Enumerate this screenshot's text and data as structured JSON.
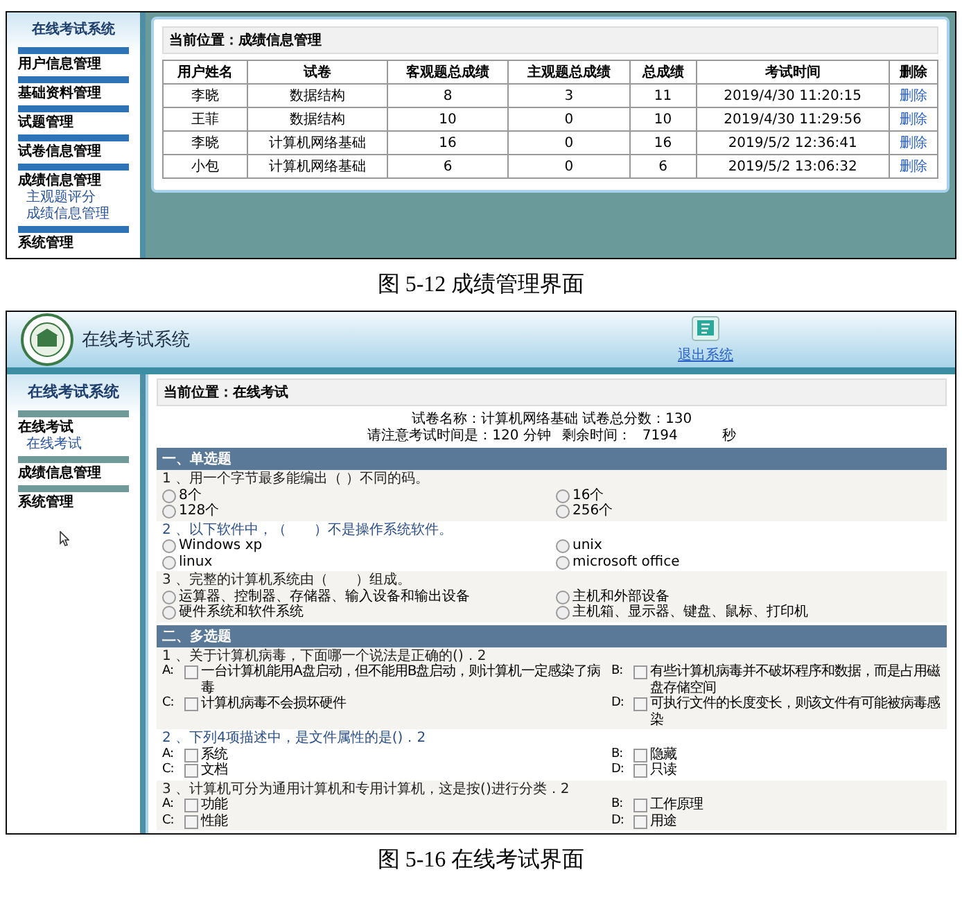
{
  "figures": [
    {
      "kind": "grades",
      "caption": "图 5-12 成绩管理界面",
      "sidebar": {
        "title": "在线考试系统",
        "items": [
          {
            "label": "用户信息管理"
          },
          {
            "label": "基础资料管理"
          },
          {
            "label": "试题管理"
          },
          {
            "label": "试卷信息管理"
          },
          {
            "label": "成绩信息管理",
            "children": [
              {
                "label": "主观题评分"
              },
              {
                "label": "成绩信息管理"
              }
            ]
          },
          {
            "label": "系统管理"
          }
        ]
      },
      "breadcrumb": "当前位置：成绩信息管理",
      "table": {
        "columns": [
          "用户姓名",
          "试卷",
          "客观题总成绩",
          "主观题总成绩",
          "总成绩",
          "考试时间",
          "删除"
        ],
        "rows": [
          {
            "cells": [
              "李晓",
              "数据结构",
              "8",
              "3",
              "11",
              "2019/4/30 11:20:15"
            ],
            "action": "删除"
          },
          {
            "cells": [
              "王菲",
              "数据结构",
              "10",
              "0",
              "10",
              "2019/4/30 11:29:56"
            ],
            "action": "删除"
          },
          {
            "cells": [
              "李晓",
              "计算机网络基础",
              "16",
              "0",
              "16",
              "2019/5/2 12:36:41"
            ],
            "action": "删除"
          },
          {
            "cells": [
              "小包",
              "计算机网络基础",
              "6",
              "0",
              "6",
              "2019/5/2 13:06:32"
            ],
            "action": "删除"
          }
        ]
      }
    },
    {
      "kind": "exam",
      "caption": "图 5-16 在线考试界面",
      "header": {
        "title": "在线考试系统",
        "logout": "退出系统"
      },
      "sidebar": {
        "title": "在线考试系统",
        "items": [
          {
            "label": "在线考试",
            "children": [
              {
                "label": "在线考试"
              }
            ]
          },
          {
            "label": "成绩信息管理"
          },
          {
            "label": "系统管理"
          }
        ]
      },
      "breadcrumb": "当前位置：在线考试",
      "exam_info": {
        "paper": "试卷名称：计算机网络基础 试卷总分数：130",
        "time_note": "请注意考试时间是：120 分钟",
        "remaining_label": "剩余时间：",
        "remaining": "7194",
        "unit": "秒"
      },
      "sections": [
        {
          "kind": "single",
          "title": "一、单选题",
          "questions": [
            {
              "text": "1 、用一个字节最多能编出（ ）不同的码。",
              "options": [
                {
                  "label": "8个",
                  "selected": false
                },
                {
                  "label": "16个",
                  "selected": false
                },
                {
                  "label": "128个",
                  "selected": false
                },
                {
                  "label": "256个",
                  "selected": false
                }
              ]
            },
            {
              "text": "2 、以下软件中，（　　）不是操作系统软件。",
              "options": [
                {
                  "label": "Windows xp",
                  "selected": false
                },
                {
                  "label": "unix",
                  "selected": false
                },
                {
                  "label": "linux",
                  "selected": false
                },
                {
                  "label": "microsoft office",
                  "selected": false
                }
              ]
            },
            {
              "text": "3 、完整的计算机系统由（　　）组成。",
              "options": [
                {
                  "label": "运算器、控制器、存储器、输入设备和输出设备",
                  "selected": false
                },
                {
                  "label": "主机和外部设备",
                  "selected": false
                },
                {
                  "label": "硬件系统和软件系统",
                  "selected": false
                },
                {
                  "label": "主机箱、显示器、键盘、鼠标、打印机",
                  "selected": false
                }
              ]
            }
          ]
        },
        {
          "kind": "multi",
          "title": "二、多选题",
          "questions": [
            {
              "text": "1 、关于计算机病毒，下面哪一个说法是正确的()．2",
              "options": [
                {
                  "letter": "A:",
                  "label": "一台计算机能用A盘启动，但不能用B盘启动，则计算机一定感染了病毒",
                  "checked": false
                },
                {
                  "letter": "B:",
                  "label": "有些计算机病毒并不破坏程序和数据，而是占用磁盘存储空间",
                  "checked": false
                },
                {
                  "letter": "C:",
                  "label": "计算机病毒不会损坏硬件",
                  "checked": false
                },
                {
                  "letter": "D:",
                  "label": "可执行文件的长度变长，则该文件有可能被病毒感染",
                  "checked": false
                }
              ]
            },
            {
              "text": "2 、下列4项描述中，是文件属性的是()．2",
              "options": [
                {
                  "letter": "A:",
                  "label": "系统",
                  "checked": false
                },
                {
                  "letter": "B:",
                  "label": "隐藏",
                  "checked": false
                },
                {
                  "letter": "C:",
                  "label": "文档",
                  "checked": false
                },
                {
                  "letter": "D:",
                  "label": "只读",
                  "checked": false
                }
              ]
            },
            {
              "text": "3 、计算机可分为通用计算机和专用计算机，这是按()进行分类．2",
              "options": [
                {
                  "letter": "A:",
                  "label": "功能",
                  "checked": false
                },
                {
                  "letter": "B:",
                  "label": "工作原理",
                  "checked": false
                },
                {
                  "letter": "C:",
                  "label": "性能",
                  "checked": false
                },
                {
                  "letter": "D:",
                  "label": "用途",
                  "checked": false
                }
              ]
            }
          ]
        }
      ]
    }
  ]
}
